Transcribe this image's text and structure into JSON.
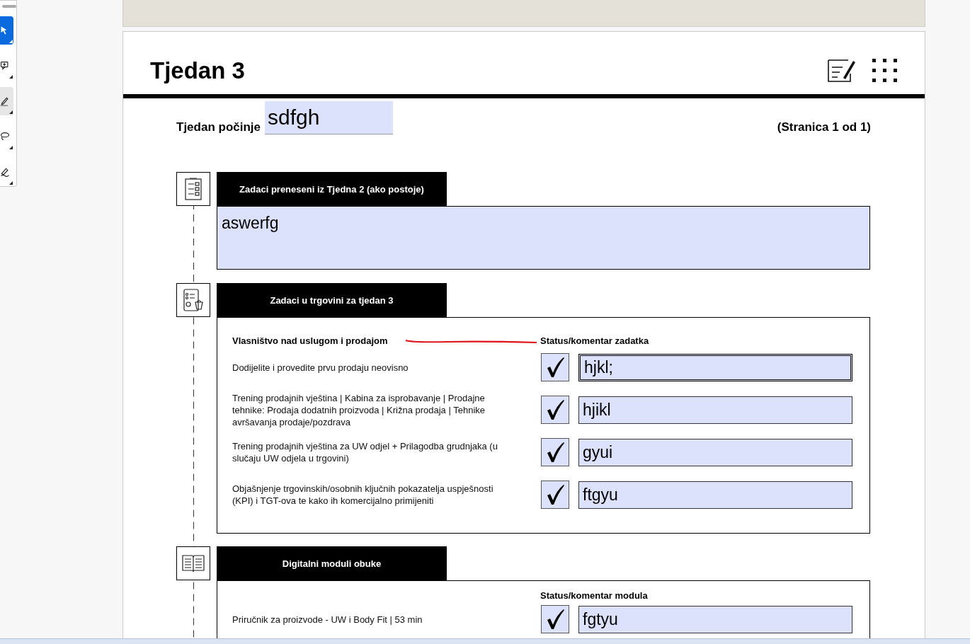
{
  "toolbar": {
    "tools": [
      {
        "selected": true
      },
      {
        "selected": false
      },
      {
        "selected": false
      },
      {
        "selected": false
      },
      {
        "selected": false
      }
    ]
  },
  "page": {
    "title": "Tjedan 3",
    "week_start": {
      "label": "Tjedan počinje",
      "value": "sdfgh"
    },
    "page_info": "(Stranica 1 od 1)"
  },
  "sections": [
    {
      "kind": "text",
      "title": "Zadaci preneseni iz Tjedna 2 (ako postoje)",
      "value": "aswerfg"
    },
    {
      "kind": "tasks",
      "title": "Zadaci u trgovini za tjedan 3",
      "group_heading": "Vlasništvo nad uslugom i prodajom",
      "status_heading": "Status/komentar zadatka",
      "tasks": [
        {
          "label": "Dodijelite i provedite prvu prodaju neovisno",
          "checked": true,
          "value": "hjkl;"
        },
        {
          "label": "Trening prodajnih vještina | Kabina za isprobavanje | Prodajne tehnike: Prodaja dodatnih proizvoda | Križna prodaja | Tehnike avršavanja prodaje/pozdrava",
          "checked": true,
          "value": "hjikl"
        },
        {
          "label": "Trening prodajnih vještina za UW odjel + Prilagodba grudnjaka (u slučaju UW odjela u trgovini)",
          "checked": true,
          "value": "gyui"
        },
        {
          "label": "Objašnjenje trgovinskih/osobnih ključnih pokazatelja uspješnosti (KPI) i TGT-ova te kako ih komercijalno primijeniti",
          "checked": true,
          "value": "ftgyu"
        }
      ]
    },
    {
      "kind": "tasks",
      "title": "Digitalni moduli obuke",
      "status_heading": "Status/komentar modula",
      "tasks": [
        {
          "label": "Priručnik za proizvode - UW i Body Fit | 53 min",
          "checked": true,
          "value": "fgtyu"
        }
      ]
    }
  ]
}
